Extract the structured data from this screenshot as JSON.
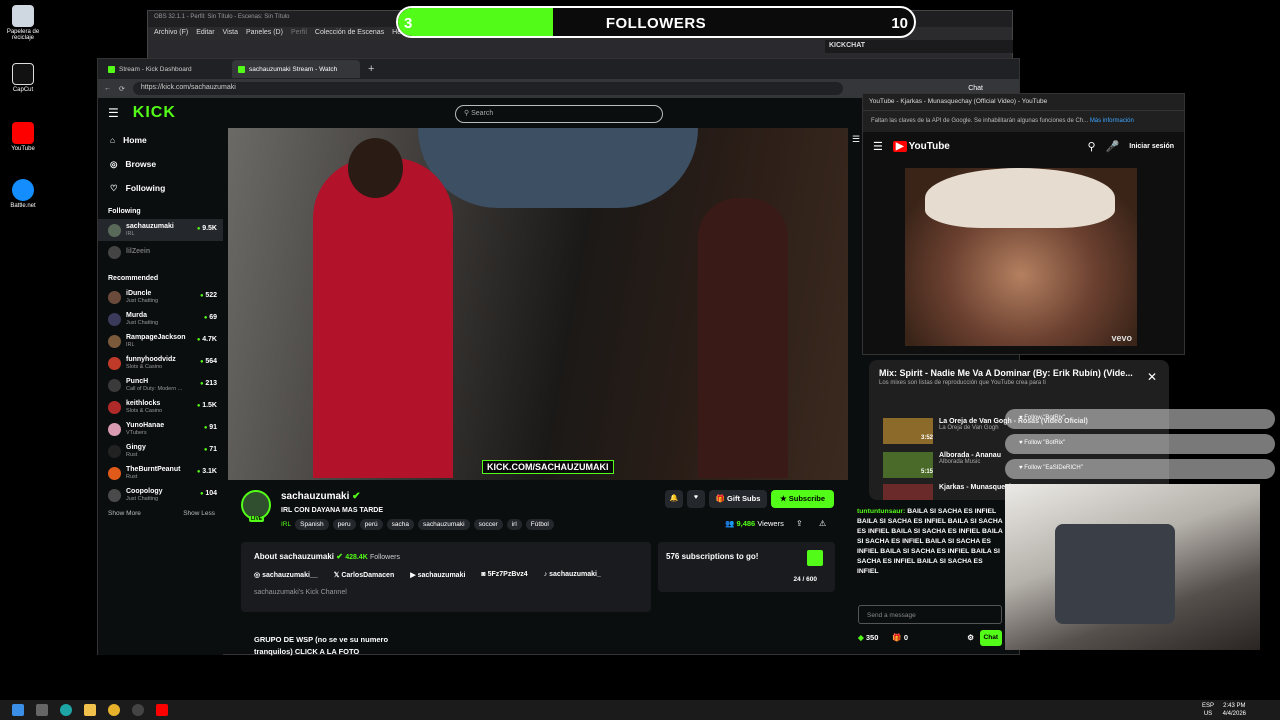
{
  "desktop": {
    "icons": [
      {
        "label": "Papelera de reciclaje",
        "color": "#cfd7e0"
      },
      {
        "label": "CapCut",
        "color": "#111111"
      },
      {
        "label": "YouTube",
        "color": "#ff0000"
      },
      {
        "label": "Battle.net",
        "color": "#148eff"
      }
    ]
  },
  "obs": {
    "title": "OBS 32.1.1 - Perfil: Sin Título - Escenas: Sin Título",
    "menu": [
      "Archivo (F)",
      "Editar",
      "Vista",
      "Paneles (D)",
      "Perfil",
      "Colección de Escenas",
      "Herram"
    ]
  },
  "followers_widget": {
    "current": "3",
    "label": "FOLLOWERS",
    "goal": "10",
    "progress_fraction": 0.3,
    "accent": "#53fc18"
  },
  "kickchat_panel": {
    "title": "KICKCHAT"
  },
  "browser": {
    "tabs": [
      {
        "title": "Stream - Kick Dashboard"
      },
      {
        "title": "sachauzumaki Stream - Watch"
      }
    ],
    "url": "https://kick.com/sachauzumaki",
    "chat_button": "Chat"
  },
  "kick": {
    "logo": "KICK",
    "search_placeholder": "Search",
    "nav": [
      {
        "label": "Home",
        "icon": "home-icon"
      },
      {
        "label": "Browse",
        "icon": "compass-icon"
      },
      {
        "label": "Following",
        "icon": "heart-icon"
      }
    ],
    "following_header": "Following",
    "following": [
      {
        "name": "sachauzumaki",
        "category": "IRL",
        "viewers": "9.5K",
        "color": "#5a6a5a"
      },
      {
        "name": "lilZeein",
        "category": "",
        "viewers": "",
        "color": "#444444"
      }
    ],
    "recommended_header": "Recommended",
    "recommended": [
      {
        "name": "iDuncle",
        "category": "Just Chatting",
        "viewers": "522",
        "color": "#6a4a3a"
      },
      {
        "name": "Murda",
        "category": "Just Chatting",
        "viewers": "69",
        "color": "#3a3a5a"
      },
      {
        "name": "RampageJackson",
        "category": "IRL",
        "viewers": "4.7K",
        "color": "#7a5a3a"
      },
      {
        "name": "funnyhoodvidz",
        "category": "Slots & Casino",
        "viewers": "564",
        "color": "#c03a2a"
      },
      {
        "name": "PuncH",
        "category": "Call of Duty: Modern ...",
        "viewers": "213",
        "color": "#3a3a3a"
      },
      {
        "name": "keithlocks",
        "category": "Slots & Casino",
        "viewers": "1.5K",
        "color": "#b02a2a"
      },
      {
        "name": "YunoHanae",
        "category": "VTubers",
        "viewers": "91",
        "color": "#d89ab0"
      },
      {
        "name": "Gingy",
        "category": "Rust",
        "viewers": "71",
        "color": "#222222"
      },
      {
        "name": "TheBurntPeanut",
        "category": "Rust",
        "viewers": "3.1K",
        "color": "#e05a1a"
      },
      {
        "name": "Coopology",
        "category": "Just Chatting",
        "viewers": "104",
        "color": "#4a4a4a"
      }
    ],
    "show_more": "Show More",
    "show_less": "Show Less",
    "video_overlay": "KICK.COM/SACHAUZUMAKI",
    "channel": {
      "name": "sachauzumaki",
      "title": "IRL CON DAYANA MAS TARDE",
      "category": "IRL",
      "tags": [
        "Spanish",
        "peru",
        "perú",
        "sacha",
        "sachauzumaki",
        "soccer",
        "irl",
        "Fútbol"
      ],
      "gift_label": "Gift Subs",
      "subscribe_label": "Subscribe",
      "viewers": "9,486",
      "viewers_label": "Viewers",
      "live": "LIVE"
    },
    "about": {
      "title": "About sachauzumaki",
      "followers": "428.4K",
      "followers_label": "Followers",
      "socials": [
        "sachauzumaki__",
        "CarlosDamacen",
        "sachauzumaki",
        "5Fz7PzBvz4",
        "sachauzumaki_"
      ],
      "description": "sachauzumaki's Kick Channel"
    },
    "sub_goal": {
      "text": "576 subscriptions to go!",
      "progress": "24 / 600"
    },
    "panel_text_1": "GRUPO DE WSP (no se ve su numero",
    "panel_text_2": "tranquilos) CLICK A LA FOTO"
  },
  "youtube": {
    "window_title": "YouTube - Kjarkas - Munasquechay (Official Video) - YouTube",
    "warning": "Faltan las claves de la API de Google. Se inhabilitarán algunas funciones de Ch...",
    "warning_link": "Más información",
    "logo": "YouTube",
    "signin": "Iniciar sesión",
    "vevo": "vevo",
    "mix_title": "Mix: Spirit - Nadie Me Va A Dominar (By: Erik Rubín) (Vide...",
    "mix_sub": "Los mixes son listas de reproducción que YouTube crea para ti",
    "items": [
      {
        "title": "La Oreja de Van Gogh - Rosas (Video Oficial)",
        "channel": "La Oreja de Van Gogh",
        "duration": "3:52"
      },
      {
        "title": "Alborada - Ananau",
        "channel": "Alborada Music",
        "duration": "5:15"
      },
      {
        "title": "Kjarkas - Munasquechay",
        "channel": "",
        "duration": ""
      }
    ]
  },
  "notifications": [
    {
      "text": "Follow \"BotRix\""
    },
    {
      "text": "Follow \"BotRix\""
    },
    {
      "text": "Follow \"EaSIDeRICH\""
    }
  ],
  "chat": {
    "username": "tuntuntunsaur:",
    "message": "BAILA SI SACHA ES INFIEL BAILA SI SACHA ES INFIEL BAILA SI SACHA ES INFIEL BAILA SI SACHA ES INFIEL BAILA SI SACHA ES INFIEL BAILA SI SACHA ES INFIEL BAILA SI SACHA ES INFIEL BAILA SI SACHA ES INFIEL BAILA SI SACHA ES INFIEL",
    "placeholder": "Send a message",
    "points": "350",
    "gifts": "0",
    "send_label": "Chat"
  },
  "taskbar": {
    "lang": "ESP",
    "region": "US",
    "time": "2:43 PM",
    "date": "4/4/2026"
  }
}
